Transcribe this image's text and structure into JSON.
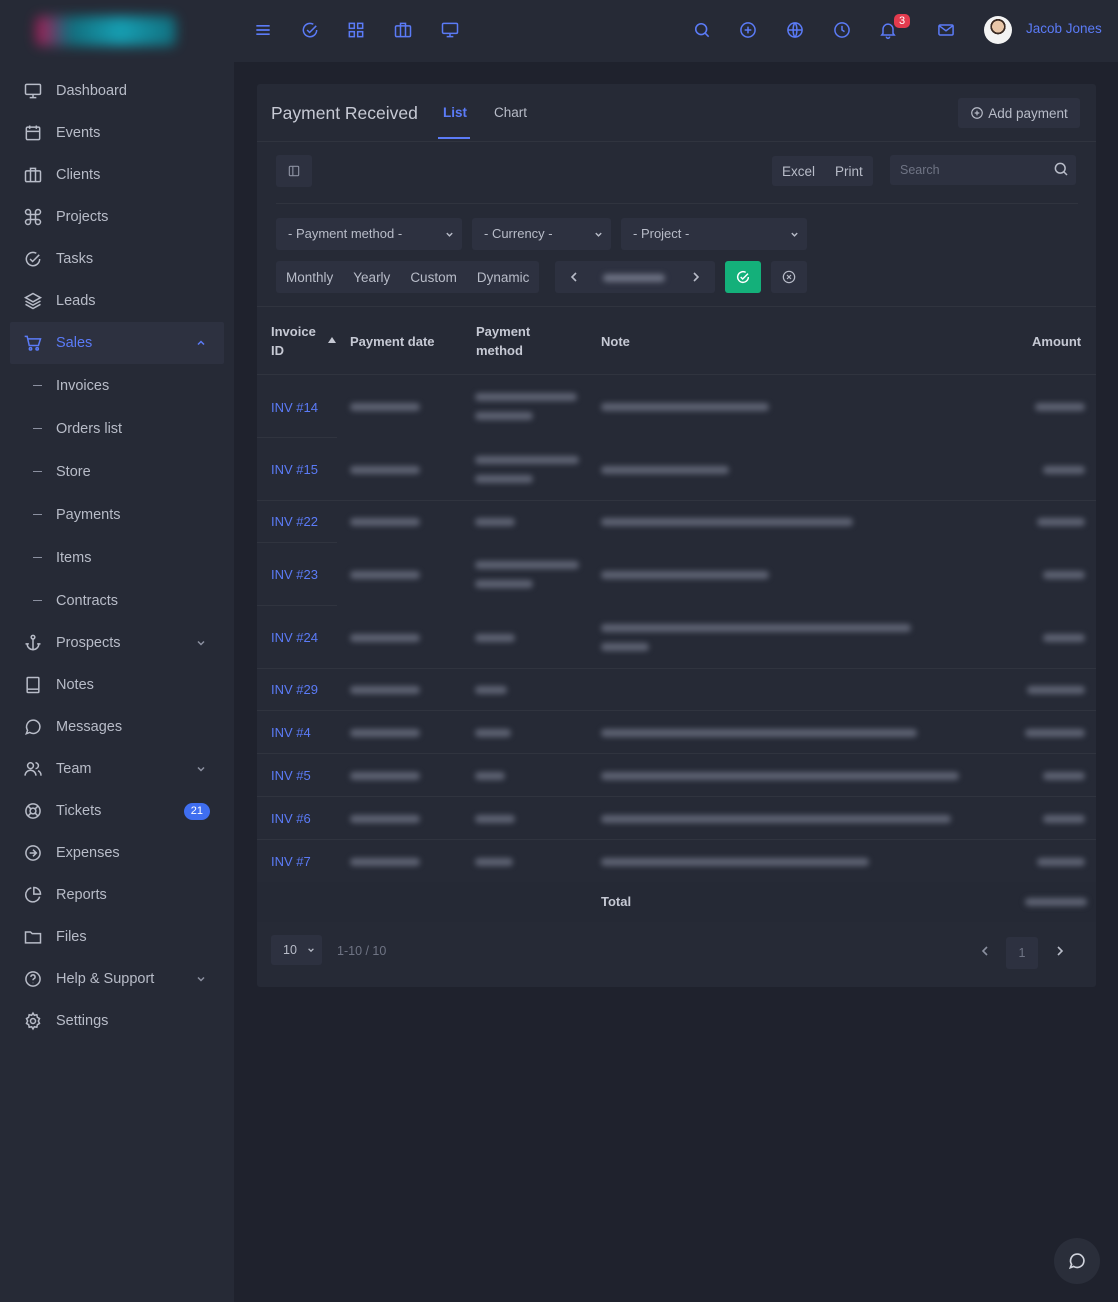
{
  "sidebar": {
    "items": [
      {
        "label": "Dashboard"
      },
      {
        "label": "Events"
      },
      {
        "label": "Clients"
      },
      {
        "label": "Projects"
      },
      {
        "label": "Tasks"
      },
      {
        "label": "Leads"
      },
      {
        "label": "Sales"
      },
      {
        "label": "Prospects"
      },
      {
        "label": "Notes"
      },
      {
        "label": "Messages"
      },
      {
        "label": "Team"
      },
      {
        "label": "Tickets",
        "badge": "21"
      },
      {
        "label": "Expenses"
      },
      {
        "label": "Reports"
      },
      {
        "label": "Files"
      },
      {
        "label": "Help & Support"
      },
      {
        "label": "Settings"
      }
    ],
    "sales_sub": [
      "Invoices",
      "Orders list",
      "Store",
      "Payments",
      "Items",
      "Contracts"
    ]
  },
  "topbar": {
    "notification_count": "3",
    "user_name": "Jacob Jones"
  },
  "card": {
    "title": "Payment Received",
    "tabs": [
      "List",
      "Chart"
    ],
    "add_button": "Add payment",
    "export_buttons": [
      "Excel",
      "Print"
    ],
    "search_placeholder": "Search",
    "filters": [
      "- Payment method -",
      "- Currency -",
      "- Project -"
    ],
    "periods": [
      "Monthly",
      "Yearly",
      "Custom",
      "Dynamic"
    ]
  },
  "table": {
    "columns": [
      "Invoice ID",
      "Payment date",
      "Payment method",
      "Note",
      "Amount"
    ],
    "rows": [
      {
        "invoice": "INV #14"
      },
      {
        "invoice": "INV #15"
      },
      {
        "invoice": "INV #22"
      },
      {
        "invoice": "INV #23"
      },
      {
        "invoice": "INV #24"
      },
      {
        "invoice": "INV #29"
      },
      {
        "invoice": "INV #4"
      },
      {
        "invoice": "INV #5"
      },
      {
        "invoice": "INV #6"
      },
      {
        "invoice": "INV #7"
      }
    ],
    "total_label": "Total"
  },
  "pagination": {
    "page_size": "10",
    "info": "1-10 / 10",
    "current_page": "1"
  },
  "colors": {
    "accent": "#5b7bf7",
    "success": "#14b07a",
    "danger": "#e33b4e",
    "background": "#1f222d",
    "panel": "#262a36"
  }
}
